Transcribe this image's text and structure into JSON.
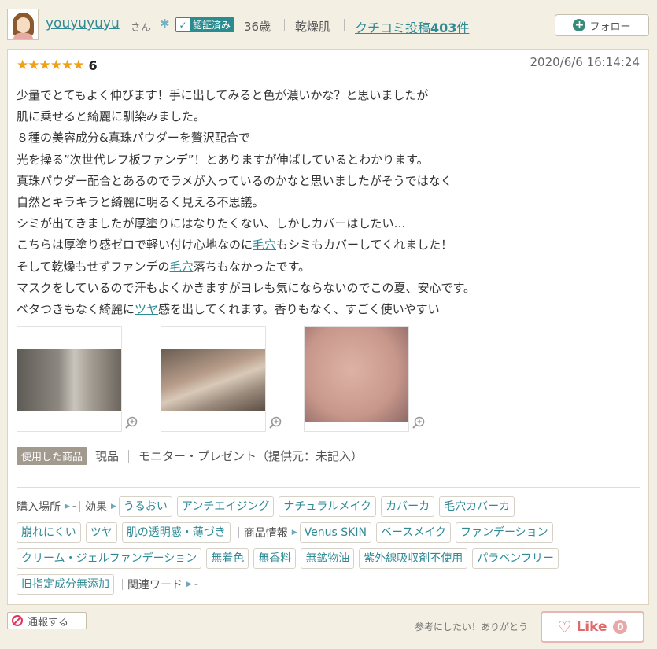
{
  "header": {
    "username": "youyuyuyu",
    "honorific": "さん",
    "verified_label": "認証済み",
    "age": "36歳",
    "skin_type": "乾燥肌",
    "reviews_prefix": "クチコミ投稿",
    "reviews_count": "403",
    "reviews_suffix": "件",
    "follow_label": "フォロー"
  },
  "review": {
    "rating": 6,
    "rating_label": "6",
    "date": "2020/6/6 16:14:24",
    "lines": [
      [
        "少量でとてもよく伸びます！手に出してみると色が濃いかな？と思いましたが"
      ],
      [
        "肌に乗せると綺麗に馴染みました。"
      ],
      [
        "８種の美容成分&真珠パウダーを贅沢配合で"
      ],
      [
        "光を操る”次世代レフ板ファンデ”！とありますが伸ばしているとわかります。"
      ],
      [
        "真珠パウダー配合とあるのでラメが入っているのかなと思いましたがそうではなく"
      ],
      [
        "自然とキラキラと綺麗に明るく見える不思議。"
      ],
      [
        "シミが出てきましたが厚塗りにはなりたくない、しかしカバーはしたい…"
      ],
      [
        "こちらは厚塗り感ゼロで軽い付け心地なのに",
        "毛穴",
        "もシミもカバーしてくれました！"
      ],
      [
        "そして乾燥もせずファンデの",
        "毛穴",
        "落ちもなかったです。"
      ],
      [
        "マスクをしているので汗もよくかきますがヨレも気にならないのでこの夏、安心です。"
      ],
      [
        "ベタつきもなく綺麗に",
        "ツヤ",
        "感を出してくれます。香りもなく、すごく使いやすい"
      ]
    ]
  },
  "used_product": {
    "label": "使用した商品",
    "type": "現品",
    "source": "モニター・プレゼント（提供元：未記入）"
  },
  "tags": {
    "purchase_label": "購入場所",
    "purchase_value": "-",
    "effect_label": "効果",
    "effects": [
      "うるおい",
      "アンチエイジング",
      "ナチュラルメイク",
      "カバーカ",
      "毛穴カバーカ",
      "崩れにくい",
      "ツヤ",
      "肌の透明感・薄づき"
    ],
    "info_label": "商品情報",
    "info": [
      "Venus SKIN",
      "ベースメイク",
      "ファンデーション",
      "クリーム・ジェルファンデーション",
      "無着色",
      "無香料",
      "無鉱物油",
      "紫外線吸収剤不使用",
      "パラベンフリー",
      "旧指定成分無添加"
    ],
    "related_label": "関連ワード",
    "related_value": "-"
  },
  "footer": {
    "report_label": "通報する",
    "helpful_text": "参考にしたい！ありがとう",
    "like_label": "Like",
    "like_count": "0"
  },
  "colors": {
    "accent": "#2f8a94",
    "star": "#f0a018",
    "like": "#e06a6a"
  },
  "icons": [
    "avatar",
    "snowflake-icon",
    "check-icon",
    "plus-icon",
    "star-icon",
    "zoom-icon",
    "report-icon",
    "heart-icon"
  ]
}
